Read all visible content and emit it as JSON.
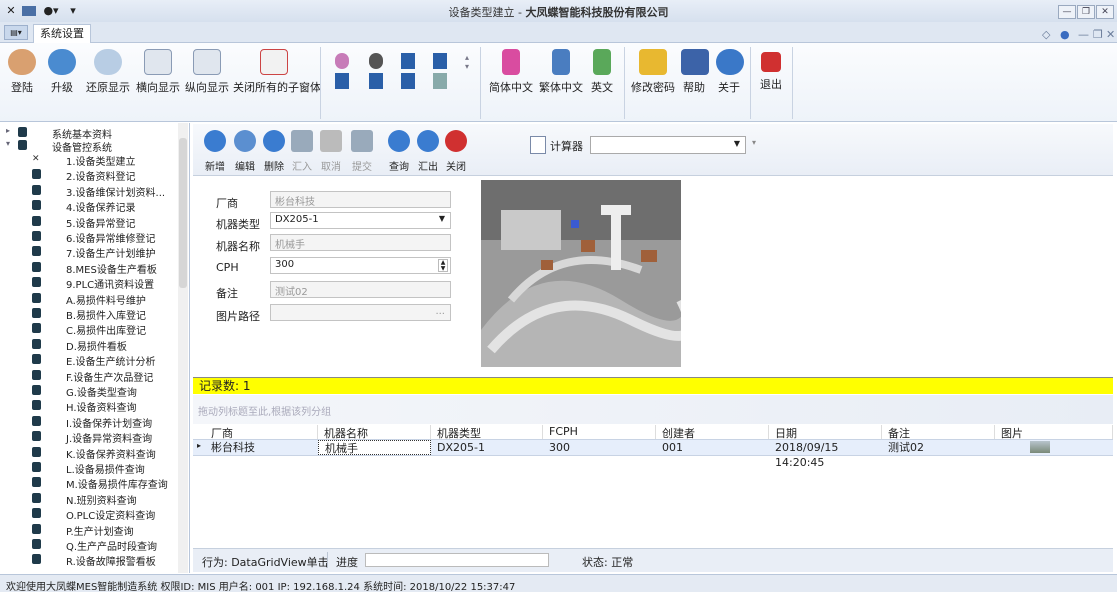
{
  "window": {
    "title_prefix": "设备类型建立 - ",
    "title_company": "大凤蝶智能科技股份有限公司"
  },
  "tab_active": "系统设置",
  "ribbon": {
    "buttons": [
      "登陆",
      "升级",
      "还原显示",
      "横向显示",
      "纵向显示",
      "关闭所有的子窗体",
      "简体中文",
      "繁体中文",
      "英文",
      "修改密码",
      "帮助",
      "关于",
      "退出"
    ]
  },
  "tree": {
    "root1": "系统基本资料",
    "root2": "设备管控系统",
    "items": [
      "1.设备类型建立",
      "2.设备资料登记",
      "3.设备维保计划资料...",
      "4.设备保养记录",
      "5.设备异常登记",
      "6.设备异常维修登记",
      "7.设备生产计划维护",
      "8.MES设备生产看板",
      "9.PLC通讯资料设置",
      "A.易损件料号维护",
      "B.易损件入库登记",
      "C.易损件出库登记",
      "D.易损件看板",
      "E.设备生产统计分析",
      "F.设备生产次品登记",
      "G.设备类型查询",
      "H.设备资料查询",
      "I.设备保养计划查询",
      "J.设备异常资料查询",
      "K.设备保养资料查询",
      "L.设备易损件查询",
      "M.设备易损件库存查询",
      "N.班别资料查询",
      "O.PLC设定资料查询",
      "P.生产计划查询",
      "Q.生产产品时段查询",
      "R.设备故障报警看板"
    ]
  },
  "toolbar": {
    "buttons": [
      "新增",
      "编辑",
      "删除",
      "汇入",
      "取消",
      "提交",
      "查询",
      "汇出",
      "关闭"
    ],
    "calc_label": "计算器"
  },
  "form": {
    "vendor_label": "厂商",
    "vendor_value": "彬台科技",
    "type_label": "机器类型",
    "type_value": "DX205-1",
    "name_label": "机器名称",
    "name_value": "机械手",
    "cph_label": "CPH",
    "cph_value": "300",
    "remark_label": "备注",
    "remark_value": "测试02",
    "path_label": "图片路径",
    "path_value": "..."
  },
  "grid": {
    "count_text": "记录数: 1",
    "group_hint": "拖动列标题至此,根据该列分组",
    "columns": [
      "厂商",
      "机器名称",
      "机器类型",
      "FCPH",
      "创建者",
      "日期",
      "备注",
      "图片"
    ],
    "row": [
      "彬台科技",
      "机械手",
      "DX205-1",
      "300",
      "001",
      "2018/09/15 14:20:45",
      "测试02"
    ]
  },
  "status": {
    "action": "行为: DataGridView单击",
    "progress_label": "进度",
    "state": "状态: 正常"
  },
  "footer": "欢迎使用大凤蝶MES智能制造系统  权限ID: MIS  用户名: 001  IP: 192.168.1.24  系统时间: 2018/10/22 15:37:47",
  "colors": {
    "accent": "#ffff00",
    "selection": "#e6eefb"
  }
}
